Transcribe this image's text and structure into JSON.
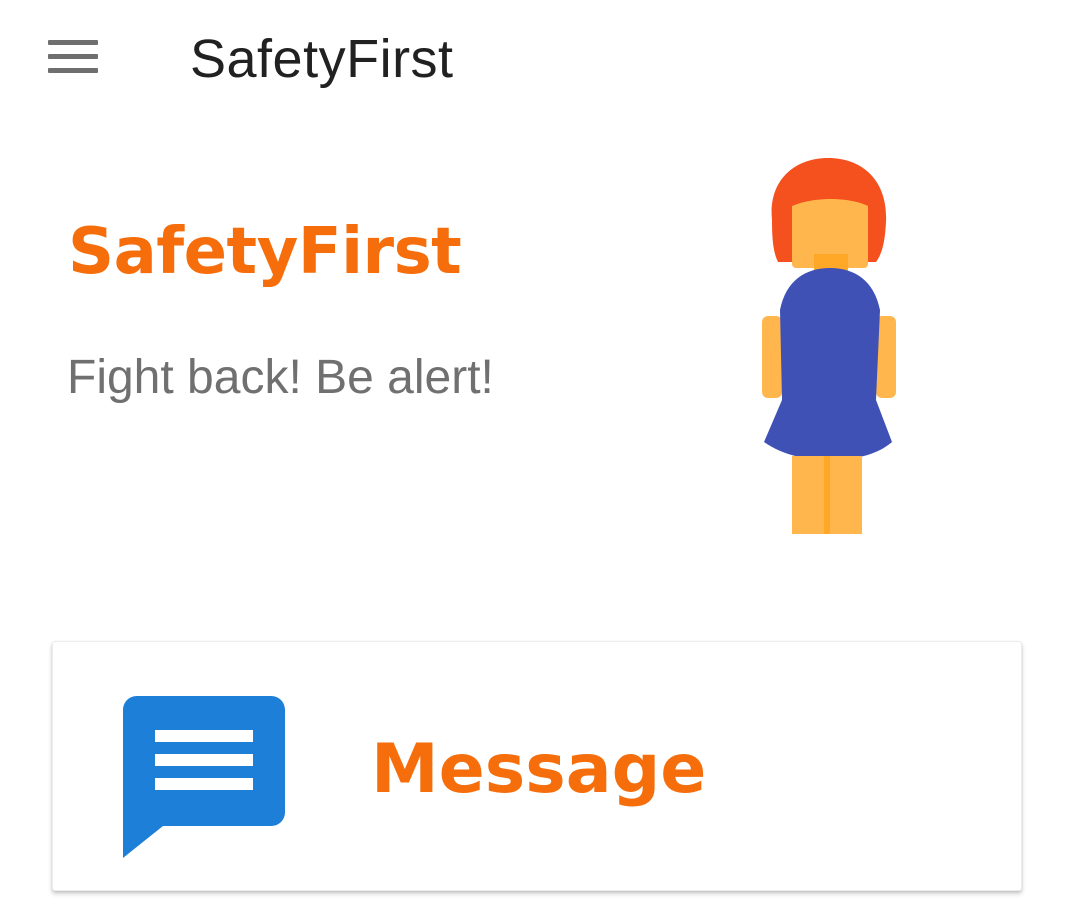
{
  "app_bar": {
    "title": "SafetyFirst",
    "menu_icon": "hamburger-menu-icon"
  },
  "hero": {
    "title": "SafetyFirst",
    "subtitle": "Fight back! Be alert!",
    "illustration": "woman-icon"
  },
  "card": {
    "label": "Message",
    "icon": "message-icon"
  },
  "colors": {
    "accent": "#f56e0b",
    "title_text": "#212121",
    "subtitle_text": "#707070",
    "message_icon": "#1e7fd8",
    "dress": "#3f51b5",
    "hair": "#f4511e",
    "skin": "#ffb74d"
  }
}
